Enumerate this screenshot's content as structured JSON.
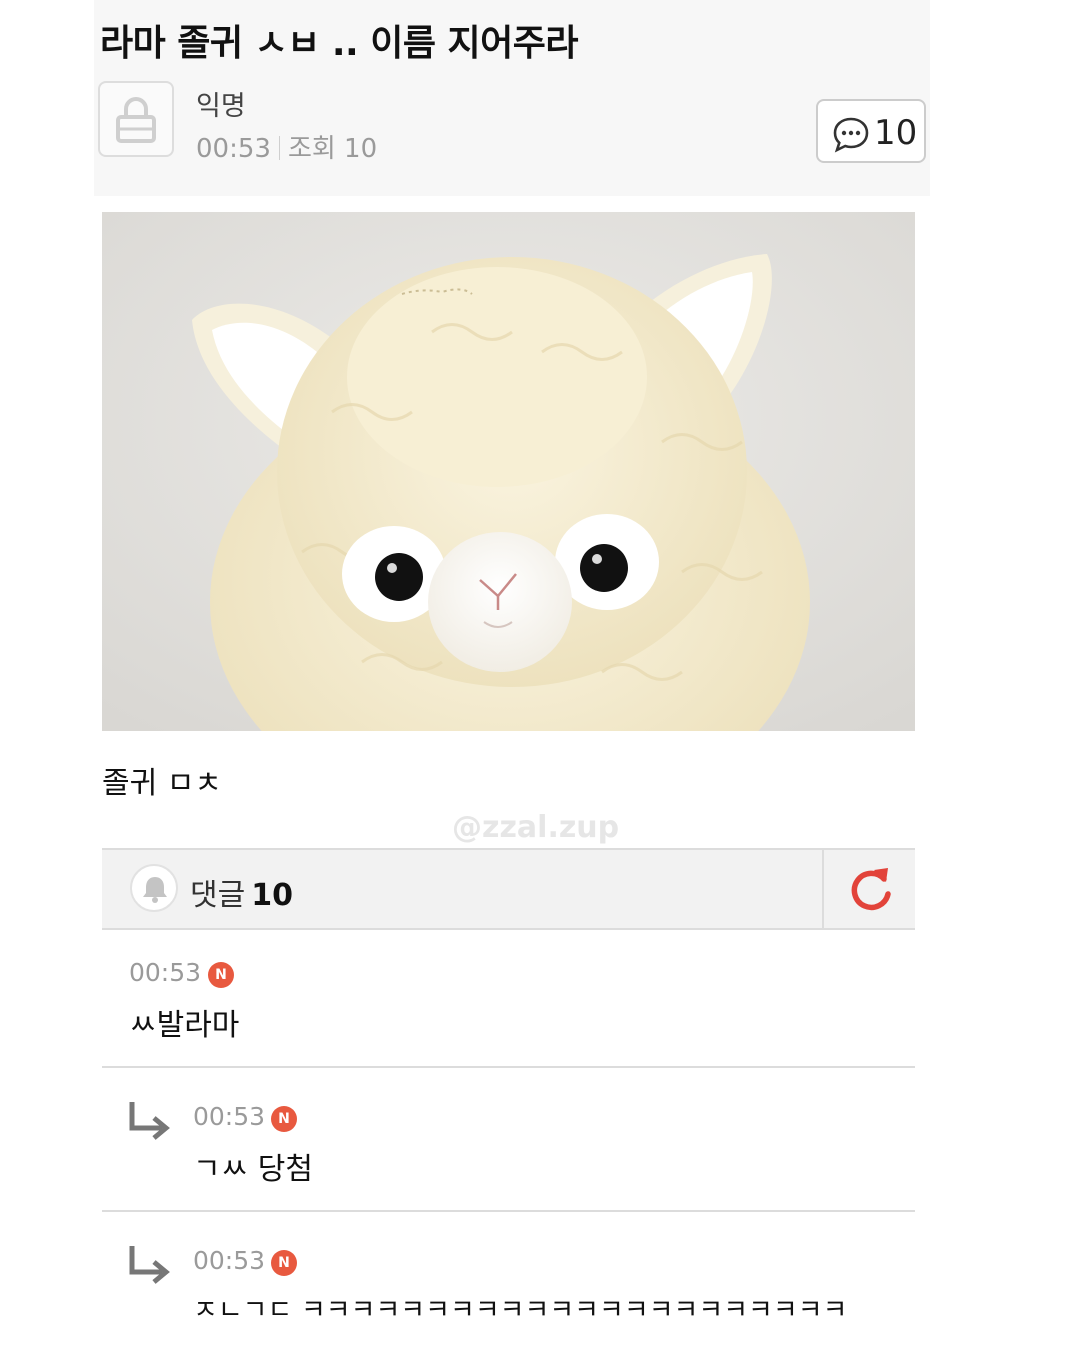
{
  "post": {
    "title": "라마 졸귀 ㅅㅂ .. 이름 지어주라",
    "author": "익명",
    "time": "00:53",
    "views_label": "조회 10",
    "comment_count": "10",
    "body_text": "졸귀 ㅁㅊ"
  },
  "watermark": "@zzal.zup",
  "comments_bar": {
    "label": "댓글",
    "count": "10"
  },
  "comments": [
    {
      "time": "00:53",
      "badge": "N",
      "text": "ㅆ발라마",
      "is_reply": false
    },
    {
      "time": "00:53",
      "badge": "N",
      "text": "ㄱㅆ 당첨",
      "is_reply": true
    },
    {
      "time": "00:53",
      "badge": "N",
      "text": "ㅈㄴㄱㄷ ㅋㅋㅋㅋㅋㅋㅋㅋㅋㅋㅋㅋㅋㅋㅋㅋㅋㅋㅋㅋㅋㅋ",
      "is_reply": true
    }
  ],
  "colors": {
    "badge": "#e8593f",
    "refresh": "#e2433a",
    "header_bg": "#f7f7f7",
    "llama_fur": "#f4ebcf"
  },
  "icons": [
    "lock-icon",
    "speech-bubble-icon",
    "bell-icon",
    "refresh-icon",
    "reply-arrow-icon"
  ]
}
